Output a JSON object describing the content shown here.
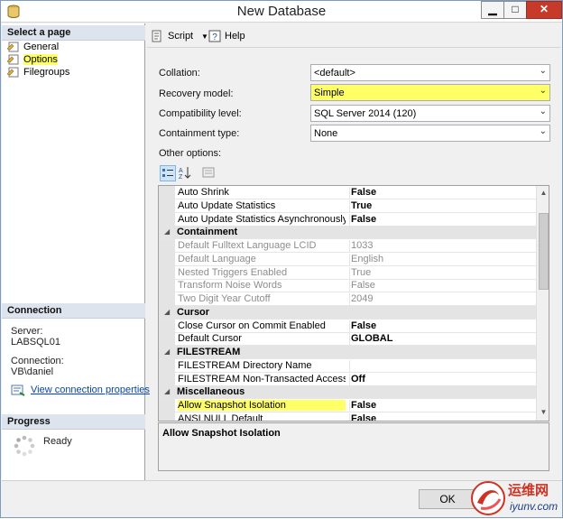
{
  "window": {
    "title": "New Database"
  },
  "left_panel": {
    "select_page_header": "Select a page",
    "pages": [
      {
        "label": "General",
        "icon": "page-icon"
      },
      {
        "label": "Options",
        "icon": "page-icon",
        "selected": true
      },
      {
        "label": "Filegroups",
        "icon": "page-icon"
      }
    ],
    "connection_header": "Connection",
    "server_label": "Server:",
    "server_value": "LABSQL01",
    "connection_label": "Connection:",
    "connection_value": "VB\\daniel",
    "view_properties_link": "View connection properties",
    "progress_header": "Progress",
    "progress_status": "Ready"
  },
  "toolbar": {
    "script_label": "Script",
    "help_label": "Help"
  },
  "form": {
    "collation_label": "Collation:",
    "collation_value": "<default>",
    "recovery_label": "Recovery model:",
    "recovery_value": "Simple",
    "compat_label": "Compatibility level:",
    "compat_value": "SQL Server 2014 (120)",
    "containment_label": "Containment type:",
    "containment_value": "None",
    "other_options_label": "Other options:"
  },
  "grid_rows": [
    {
      "type": "prop",
      "name": "Auto Shrink",
      "value": "False"
    },
    {
      "type": "prop",
      "name": "Auto Update Statistics",
      "value": "True"
    },
    {
      "type": "prop",
      "name": "Auto Update Statistics Asynchronously",
      "value": "False"
    },
    {
      "type": "category",
      "name": "Containment"
    },
    {
      "type": "prop",
      "name": "Default Fulltext Language LCID",
      "value": "1033",
      "disabled": true
    },
    {
      "type": "prop",
      "name": "Default Language",
      "value": "English",
      "disabled": true
    },
    {
      "type": "prop",
      "name": "Nested Triggers Enabled",
      "value": "True",
      "disabled": true
    },
    {
      "type": "prop",
      "name": "Transform Noise Words",
      "value": "False",
      "disabled": true
    },
    {
      "type": "prop",
      "name": "Two Digit Year Cutoff",
      "value": "2049",
      "disabled": true
    },
    {
      "type": "category",
      "name": "Cursor"
    },
    {
      "type": "prop",
      "name": "Close Cursor on Commit Enabled",
      "value": "False"
    },
    {
      "type": "prop",
      "name": "Default Cursor",
      "value": "GLOBAL"
    },
    {
      "type": "category",
      "name": "FILESTREAM"
    },
    {
      "type": "prop",
      "name": "FILESTREAM Directory Name",
      "value": ""
    },
    {
      "type": "prop",
      "name": "FILESTREAM Non-Transacted Access",
      "value": "Off"
    },
    {
      "type": "category",
      "name": "Miscellaneous"
    },
    {
      "type": "prop",
      "name": "Allow Snapshot Isolation",
      "value": "False",
      "selected": true
    },
    {
      "type": "prop",
      "name": "ANSI NULL Default",
      "value": "False"
    }
  ],
  "description": {
    "title": "Allow Snapshot Isolation"
  },
  "buttons": {
    "ok_label": "OK"
  },
  "watermark": {
    "text": "运维网",
    "subtext": "iyunv.com"
  },
  "colors": {
    "highlight": "#ffff66",
    "section_header": "#dde4ee",
    "close_button": "#c73a2a",
    "link": "#0645ad"
  }
}
